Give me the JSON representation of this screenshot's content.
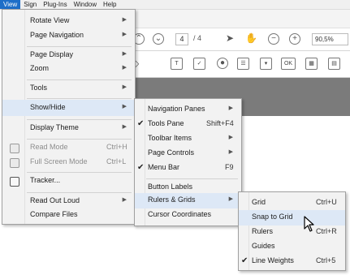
{
  "menubar": {
    "items": [
      "View",
      "Sign",
      "Plug-Ins",
      "Window",
      "Help"
    ]
  },
  "toolbar": {
    "page_current": "4",
    "page_total": "/ 4",
    "zoom": "90,5%",
    "ok_label": "OK"
  },
  "view_menu": {
    "items": [
      {
        "label": "Rotate View"
      },
      {
        "label": "Page Navigation"
      },
      {
        "label": "Page Display"
      },
      {
        "label": "Zoom"
      },
      {
        "label": "Tools"
      },
      {
        "label": "Show/Hide"
      },
      {
        "label": "Display Theme"
      },
      {
        "label": "Read Mode",
        "shortcut": "Ctrl+H"
      },
      {
        "label": "Full Screen Mode",
        "shortcut": "Ctrl+L"
      },
      {
        "label": "Tracker..."
      },
      {
        "label": "Read Out Loud"
      },
      {
        "label": "Compare Files"
      }
    ]
  },
  "showhide_menu": {
    "items": [
      {
        "label": "Navigation Panes"
      },
      {
        "label": "Tools Pane",
        "shortcut": "Shift+F4",
        "checked": true
      },
      {
        "label": "Toolbar Items"
      },
      {
        "label": "Page Controls"
      },
      {
        "label": "Menu Bar",
        "shortcut": "F9",
        "checked": true
      },
      {
        "label": "Button Labels"
      },
      {
        "label": "Rulers & Grids"
      },
      {
        "label": "Cursor Coordinates"
      }
    ]
  },
  "rulers_menu": {
    "items": [
      {
        "label": "Grid",
        "shortcut": "Ctrl+U"
      },
      {
        "label": "Snap to Grid"
      },
      {
        "label": "Rulers",
        "shortcut": "Ctrl+R"
      },
      {
        "label": "Guides"
      },
      {
        "label": "Line Weights",
        "shortcut": "Ctrl+5",
        "checked": true
      }
    ]
  },
  "colors": {
    "highlight": "#dde8f6",
    "menu_bg": "#f2f2f2",
    "active_menu": "#1e6ec8"
  }
}
